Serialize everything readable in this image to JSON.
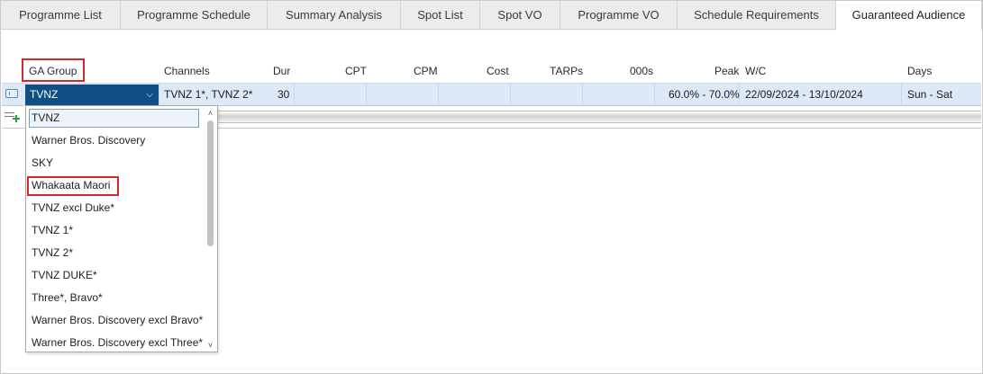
{
  "tabs": [
    {
      "label": "Programme List",
      "active": false
    },
    {
      "label": "Programme Schedule",
      "active": false
    },
    {
      "label": "Summary Analysis",
      "active": false
    },
    {
      "label": "Spot List",
      "active": false
    },
    {
      "label": "Spot VO",
      "active": false
    },
    {
      "label": "Programme VO",
      "active": false
    },
    {
      "label": "Schedule Requirements",
      "active": false
    },
    {
      "label": "Guaranteed Audience",
      "active": true
    }
  ],
  "grid": {
    "headers": {
      "ga_group": "GA Group",
      "channels": "Channels",
      "dur": "Dur",
      "cpt": "CPT",
      "cpm": "CPM",
      "cost": "Cost",
      "tarps": "TARPs",
      "thousands": "000s",
      "peak": "Peak",
      "wc": "W/C",
      "days": "Days"
    },
    "row": {
      "ga_group": "TVNZ",
      "channels": "TVNZ 1*, TVNZ 2*",
      "dur": "30",
      "cpt": "",
      "cpm": "",
      "cost": "",
      "tarps": "",
      "thousands": "",
      "peak": "60.0% - 70.0%",
      "wc": "22/09/2024 - 13/10/2024",
      "days": "Sun - Sat"
    }
  },
  "dropdown": {
    "items": [
      "TVNZ",
      "Warner Bros. Discovery",
      "SKY",
      "Whakaata Maori",
      "TVNZ excl Duke*",
      "TVNZ 1*",
      "TVNZ 2*",
      "TVNZ DUKE*",
      "Three*, Bravo*",
      "Warner Bros. Discovery excl Bravo*",
      "Warner Bros. Discovery excl Three*"
    ],
    "selected": "TVNZ",
    "highlighted": "Whakaata Maori"
  },
  "colors": {
    "selected_row": "#dde9f7",
    "combo_bg": "#0f4f86",
    "highlight_border": "#d32b2b",
    "add_green": "#2e9a3c"
  },
  "icons": {
    "row_indicator": "row-indicator-icon",
    "add_row": "add-row-icon",
    "dropdown_chevron": "chevron-down-icon",
    "scroll_up": "chevron-up-icon",
    "scroll_down": "chevron-down-icon"
  }
}
